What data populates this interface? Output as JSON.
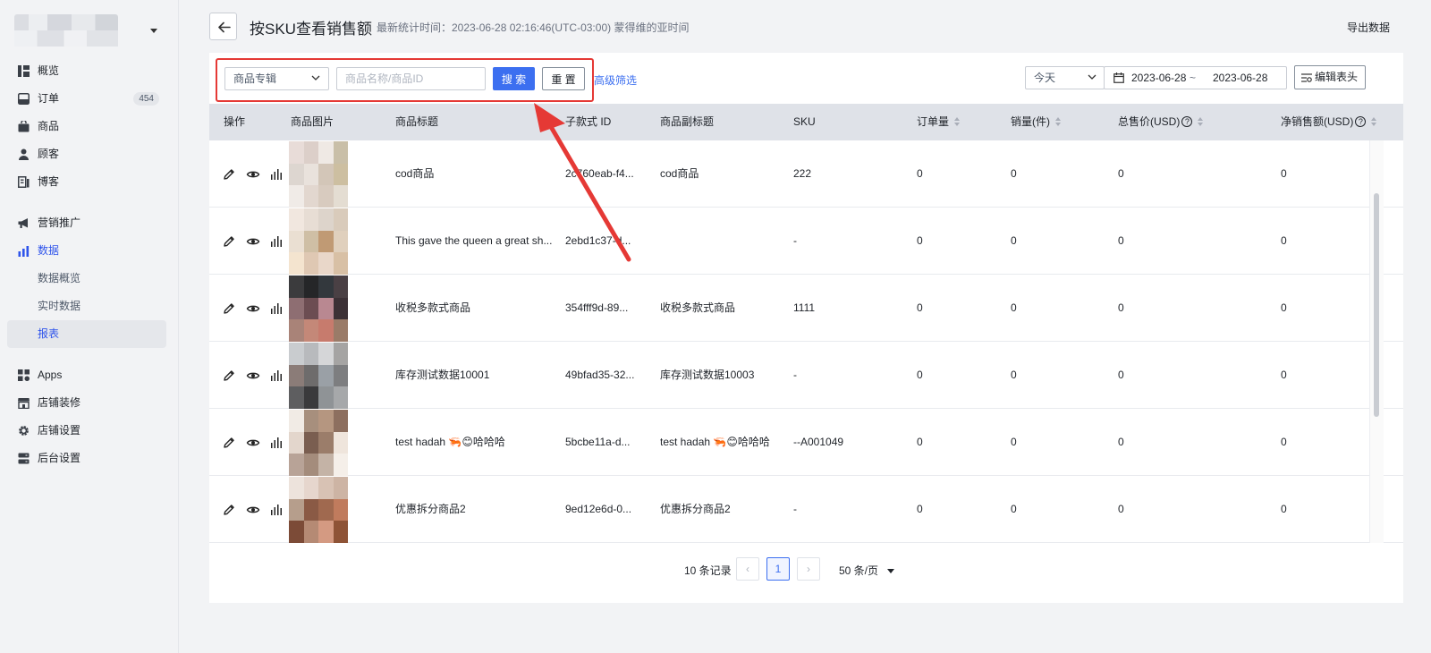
{
  "sidebar": {
    "items": [
      {
        "label": "概览",
        "icon": "overview-icon"
      },
      {
        "label": "订单",
        "icon": "inbox-icon",
        "badge": "454"
      },
      {
        "label": "商品",
        "icon": "bag-icon"
      },
      {
        "label": "顾客",
        "icon": "user-icon"
      },
      {
        "label": "博客",
        "icon": "blog-icon"
      },
      {
        "label": "营销推广",
        "icon": "megaphone-icon"
      },
      {
        "label": "数据",
        "icon": "bar-chart-icon"
      },
      {
        "label": "数据概览",
        "sub": true
      },
      {
        "label": "实时数据",
        "sub": true
      },
      {
        "label": "报表",
        "sub": true,
        "active": true
      },
      {
        "label": "Apps",
        "icon": "apps-icon"
      },
      {
        "label": "店铺装修",
        "icon": "store-icon"
      },
      {
        "label": "店铺设置",
        "icon": "gear-icon"
      },
      {
        "label": "后台设置",
        "icon": "server-icon"
      }
    ]
  },
  "header": {
    "title": "按SKU查看销售额",
    "stat_time": "最新统计时间：2023-06-28 02:16:46(UTC-03:00) 蒙得维的亚时间",
    "export": "导出数据"
  },
  "filters": {
    "scope_select": "商品专辑",
    "search_placeholder": "商品名称/商品ID",
    "search_value": "",
    "search_btn": "搜 索",
    "reset_btn": "重 置",
    "advanced": "高级筛选",
    "period": "今天",
    "date_start": "2023-06-28",
    "date_sep": "~",
    "date_end": "2023-06-28",
    "edit_columns": "编辑表头"
  },
  "table": {
    "headers": {
      "ops": "操作",
      "image": "商品图片",
      "title": "商品标题",
      "variant_id": "子款式 ID",
      "subtitle": "商品副标题",
      "sku": "SKU",
      "orders": "订单量",
      "sales_qty": "销量(件)",
      "total_price": "总售价(USD)",
      "net_sales": "净销售额(USD)"
    },
    "rows": [
      {
        "title": "cod商品",
        "variant_id": "2c760eab-f4...",
        "subtitle": "cod商品",
        "sku": "222",
        "orders": "0",
        "sales_qty": "0",
        "total_price": "0",
        "net_sales": "0"
      },
      {
        "title": "This gave the queen a great sh...",
        "variant_id": "2ebd1c37-d...",
        "subtitle": "",
        "sku": "-",
        "orders": "0",
        "sales_qty": "0",
        "total_price": "0",
        "net_sales": "0"
      },
      {
        "title": "收税多款式商品",
        "variant_id": "354fff9d-89...",
        "subtitle": "收税多款式商品",
        "sku": "1111",
        "orders": "0",
        "sales_qty": "0",
        "total_price": "0",
        "net_sales": "0"
      },
      {
        "title": "库存测试数据10001",
        "variant_id": "49bfad35-32...",
        "subtitle": "库存测试数据10003",
        "sku": "-",
        "orders": "0",
        "sales_qty": "0",
        "total_price": "0",
        "net_sales": "0"
      },
      {
        "title": "test hadah 🦐😊哈哈哈",
        "variant_id": "5bcbe11a-d...",
        "subtitle": "test hadah 🦐😊哈哈哈",
        "sku": "--A001049",
        "orders": "0",
        "sales_qty": "0",
        "total_price": "0",
        "net_sales": "0"
      },
      {
        "title": "优惠拆分商品2",
        "variant_id": "9ed12e6d-0...",
        "subtitle": "优惠拆分商品2",
        "sku": "-",
        "orders": "0",
        "sales_qty": "0",
        "total_price": "0",
        "net_sales": "0"
      }
    ]
  },
  "pagination": {
    "total": "10 条记录",
    "current_page": "1",
    "page_size": "50 条/页",
    "prev": "‹",
    "next": "›"
  },
  "colors": {
    "accent": "#3c6ff0",
    "highlight_box": "#e53935",
    "header_bg": "#dfe2e8"
  }
}
